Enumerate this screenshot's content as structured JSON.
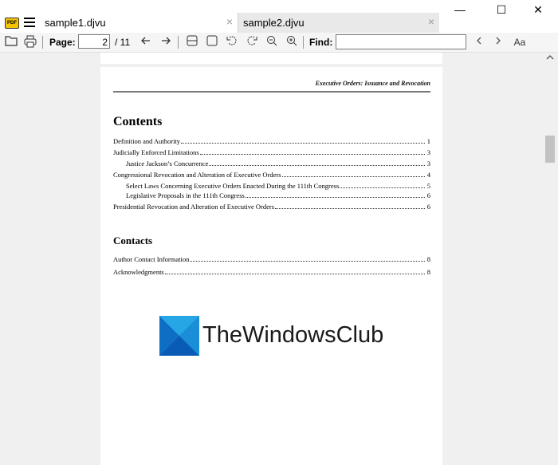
{
  "app": {
    "logo_text": "PDF",
    "tabs": [
      {
        "label": "sample1.djvu",
        "active": true
      },
      {
        "label": "sample2.djvu",
        "active": false
      }
    ],
    "tab_close": "×",
    "window_controls": {
      "minimize": "—",
      "maximize": "☐",
      "close": "✕"
    }
  },
  "toolbar": {
    "page_label": "Page:",
    "page_value": "2",
    "page_total": "/ 11",
    "find_label": "Find:",
    "find_value": "",
    "match_case_label": "Aa",
    "icons": [
      "folder-icon",
      "print-icon",
      "back-icon",
      "forward-icon",
      "single-page-icon",
      "fit-page-icon",
      "rotate-left-icon",
      "rotate-right-icon",
      "zoom-out-icon",
      "zoom-in-icon",
      "find-prev-icon",
      "find-next-icon",
      "match-case-icon"
    ]
  },
  "document": {
    "header": "Executive Orders: Issuance and Revocation",
    "contents_heading": "Contents",
    "contents": [
      {
        "text": "Definition and Authority",
        "page": "1",
        "indent": false
      },
      {
        "text": "Judicially Enforced Limitations",
        "page": "3",
        "indent": false
      },
      {
        "text": "Justice Jackson’s Concurrence",
        "page": "3",
        "indent": true
      },
      {
        "text": "Congressional Revocation and Alteration of Executive Orders",
        "page": "4",
        "indent": false
      },
      {
        "text": "Select Laws Concerning Executive Orders Enacted During the 111th Congress",
        "page": "5",
        "indent": true
      },
      {
        "text": "Legislative Proposals in the 111th Congress",
        "page": "6",
        "indent": true
      },
      {
        "text": "Presidential Revocation and Alteration of Executive Orders",
        "page": "6",
        "indent": false
      }
    ],
    "contacts_heading": "Contacts",
    "contacts": [
      {
        "text": "Author Contact Information",
        "page": "8",
        "indent": false
      },
      {
        "text": "Acknowledgments",
        "page": "8",
        "indent": false
      }
    ]
  },
  "watermark": {
    "text": "TheWindowsClub",
    "colors": [
      "#1a8fd8",
      "#0a5bb5",
      "#27a6e6",
      "#0d6ec4"
    ]
  },
  "colors": {
    "tab_active": "#ffffff",
    "tab_inactive": "#e9e9e9",
    "background": "#f0f0f0",
    "logo_yellow": "#f5c400"
  }
}
